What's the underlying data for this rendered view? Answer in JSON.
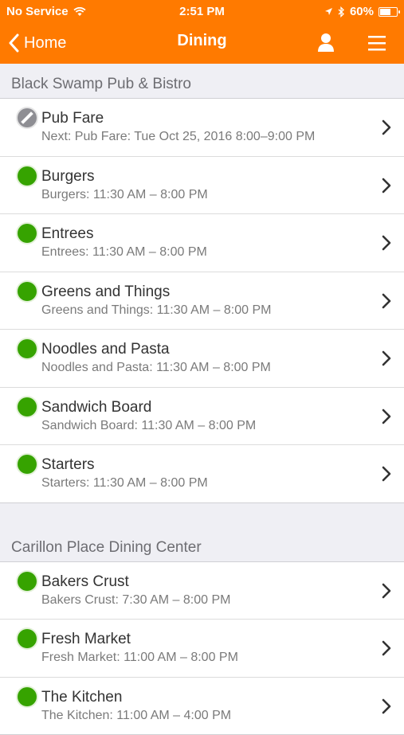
{
  "status_bar": {
    "carrier": "No Service",
    "time": "2:51 PM",
    "battery": "60%"
  },
  "navbar": {
    "back_label": "Home",
    "title": "Dining"
  },
  "sections": [
    {
      "name": "Black Swamp Pub & Bistro",
      "items": [
        {
          "title": "Pub Fare",
          "subtitle": "Next: Pub Fare: Tue Oct 25, 2016 8:00–9:00 PM",
          "status": "closed"
        },
        {
          "title": "Burgers",
          "subtitle": "Burgers: 11:30 AM – 8:00 PM",
          "status": "open"
        },
        {
          "title": "Entrees",
          "subtitle": "Entrees: 11:30 AM – 8:00 PM",
          "status": "open"
        },
        {
          "title": "Greens and Things",
          "subtitle": "Greens and Things: 11:30 AM – 8:00 PM",
          "status": "open"
        },
        {
          "title": "Noodles and Pasta",
          "subtitle": "Noodles and Pasta: 11:30 AM – 8:00 PM",
          "status": "open"
        },
        {
          "title": "Sandwich Board",
          "subtitle": "Sandwich Board: 11:30 AM – 8:00 PM",
          "status": "open"
        },
        {
          "title": "Starters",
          "subtitle": "Starters: 11:30 AM – 8:00 PM",
          "status": "open"
        }
      ]
    },
    {
      "name": "Carillon Place Dining Center",
      "items": [
        {
          "title": "Bakers Crust",
          "subtitle": "Bakers Crust: 7:30 AM – 8:00 PM",
          "status": "open"
        },
        {
          "title": "Fresh Market",
          "subtitle": "Fresh Market: 11:00 AM – 8:00 PM",
          "status": "open"
        },
        {
          "title": "The Kitchen",
          "subtitle": "The Kitchen: 11:00 AM – 4:00 PM",
          "status": "open"
        }
      ]
    }
  ],
  "colors": {
    "accent": "#ff7a00",
    "open": "#36a300",
    "closed": "#8e8e93"
  }
}
